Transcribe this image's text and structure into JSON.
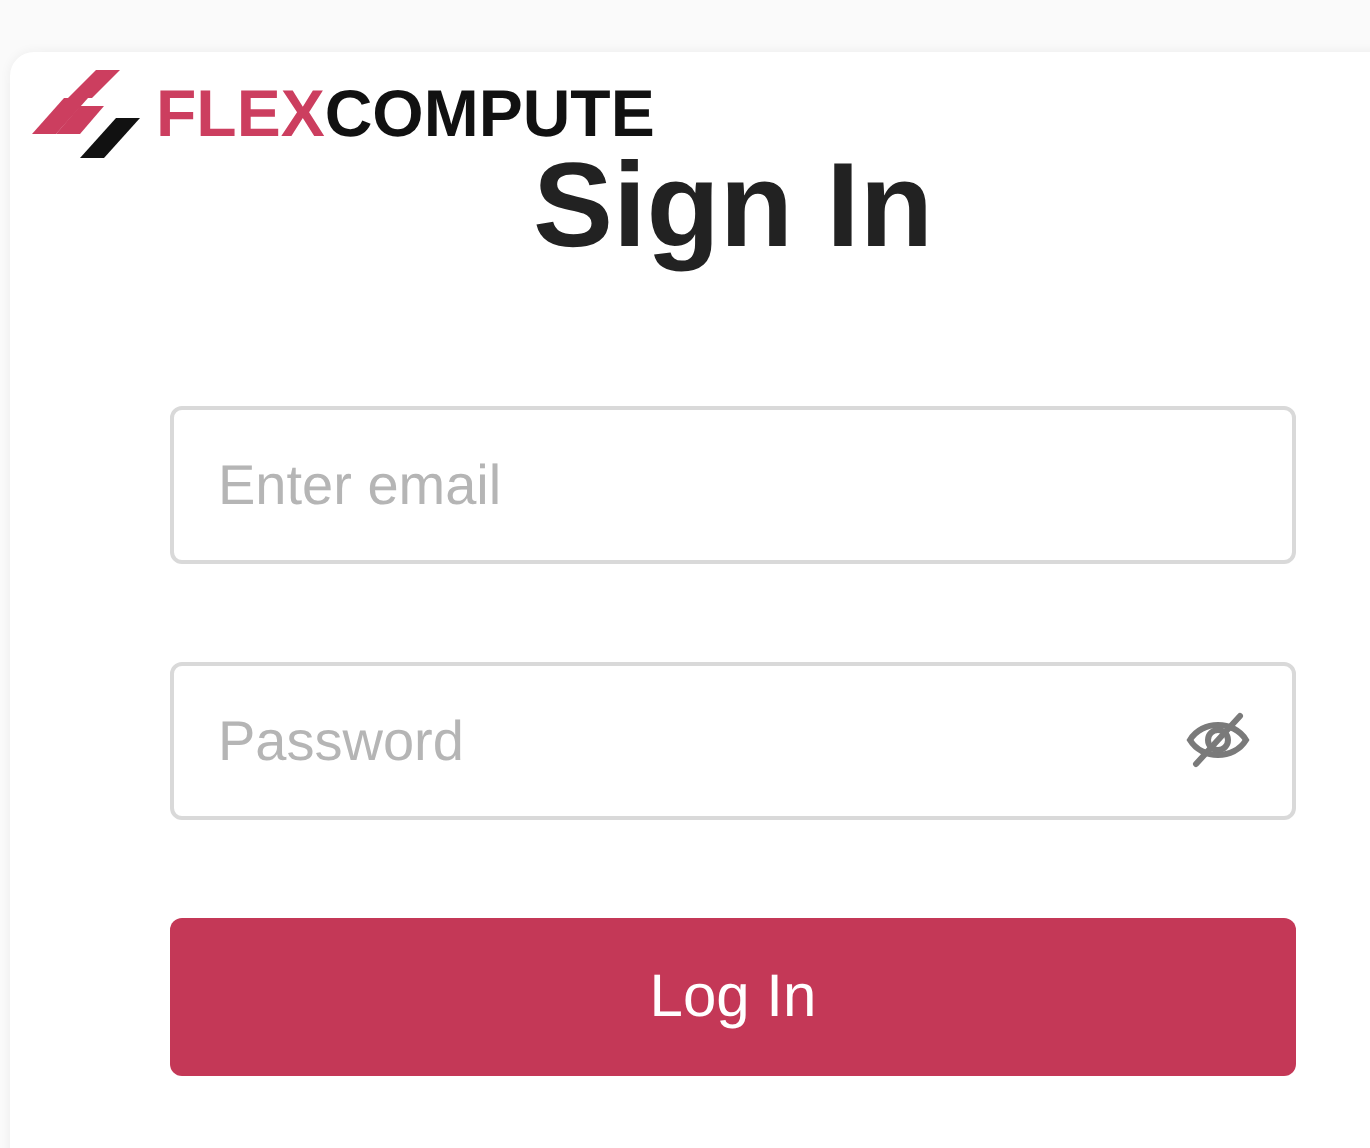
{
  "logo": {
    "part_1": "FLEX",
    "part_2": "COMPUTE"
  },
  "title": "Sign In",
  "email": {
    "placeholder": "Enter email"
  },
  "password": {
    "placeholder": "Password",
    "visible": false
  },
  "login_button": "Log In"
}
